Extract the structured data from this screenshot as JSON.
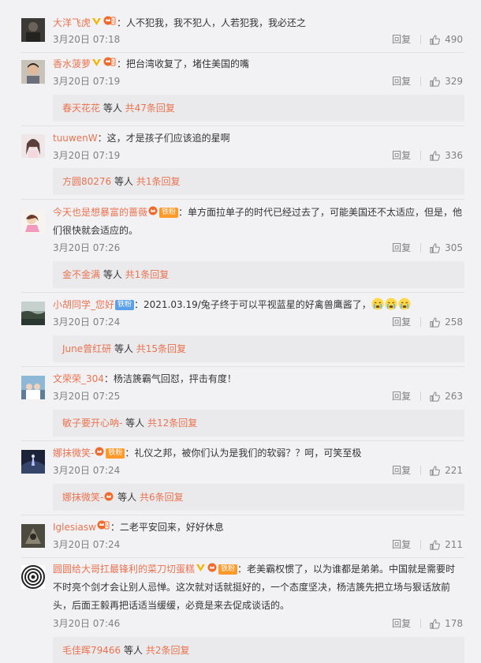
{
  "comments": [
    {
      "user": "大洋飞虎",
      "vip": true,
      "fan_label": "",
      "text": "：人不犯我，我不犯人，人若犯我，我必还之",
      "time": "3月20日 07:18",
      "reply_label": "回复",
      "likes": "490",
      "sub": null
    },
    {
      "user": "香水菠萝",
      "vip": true,
      "fan_label": "",
      "text": "：把台湾收复了，堵住美国的嘴",
      "time": "3月20日 07:19",
      "reply_label": "回复",
      "likes": "329",
      "sub": {
        "name": "春天花花",
        "mid": " 等人 ",
        "link": "共47条回复"
      }
    },
    {
      "user": "tuuwenW",
      "vip": false,
      "fan_label": "",
      "text": "：这，才是孩子们应该追的星啊",
      "time": "3月20日 07:19",
      "reply_label": "回复",
      "likes": "336",
      "sub": {
        "name": "方圆80276",
        "mid": " 等人 ",
        "link": "共1条回复"
      }
    },
    {
      "user": "今天也是想暴富的蔷薇",
      "vip": false,
      "fan_label": "铁粉",
      "text": "：单方面拉单子的时代已经过去了，可能美国还不太适应，但是，他",
      "text2": "们很快就会适应的。",
      "time": "3月20日 07:26",
      "reply_label": "回复",
      "likes": "305",
      "sub": {
        "name": "金不金满",
        "mid": " 等人 ",
        "link": "共1条回复"
      }
    },
    {
      "user": "小胡同学_您好",
      "vip": false,
      "fan_label": "铁粉",
      "text": "：2021.03.19/兔子终于可以平视蓝星的好禽兽鹰酱了，",
      "time": "3月20日 07:24",
      "reply_label": "回复",
      "likes": "258",
      "sub": {
        "name": "June曾红研",
        "mid": " 等人 ",
        "link": "共15条回复"
      }
    },
    {
      "user": "文荣荣_304",
      "vip": false,
      "fan_label": "",
      "text": "：杨洁篪霸气回怼，抨击有度！",
      "time": "3月20日 07:25",
      "reply_label": "回复",
      "likes": "263",
      "sub": {
        "name": "敏子要开心呐-",
        "mid": " 等人 ",
        "link": "共12条回复"
      }
    },
    {
      "user": "娜抹微笑-",
      "vip": false,
      "fan_label": "铁粉",
      "text": "：礼仪之邦，被你们认为是我们的软弱？？呵，可笑至极",
      "time": "3月20日 07:24",
      "reply_label": "回复",
      "likes": "221",
      "sub": {
        "name": "娜抹微笑-",
        "mid": " 等人 ",
        "link": "共6条回复"
      }
    },
    {
      "user": "Iglesiasw",
      "vip": false,
      "fan_label": "",
      "text": "：二老平安回来，好好休息",
      "time": "3月20日 07:24",
      "reply_label": "回复",
      "likes": "211",
      "sub": null
    },
    {
      "user": "圆圆给大哥扛最锋利的菜刀切蛋糕",
      "vip": true,
      "fan_label": "铁粉",
      "text": "：老美霸权惯了，以为谁都是弟弟。中国就是需要时",
      "text2": "不时亮个剑才会让别人忌惮。这次就对话就挺好的，一个态度坚决，杨洁篪先把立场与狠话放前",
      "text3": "头，后面王毅再把话适当缓缓，必竟是来去促成谈话的。",
      "time": "3月20日 07:46",
      "reply_label": "回复",
      "likes": "178",
      "sub": {
        "name": "毛佳晖79466",
        "mid": " 等人 ",
        "link": "共2条回复"
      }
    }
  ],
  "colors": {
    "name": "#eb7350",
    "time": "#808080",
    "subbg": "#eaeaec",
    "bg": "#f2f2f5"
  }
}
